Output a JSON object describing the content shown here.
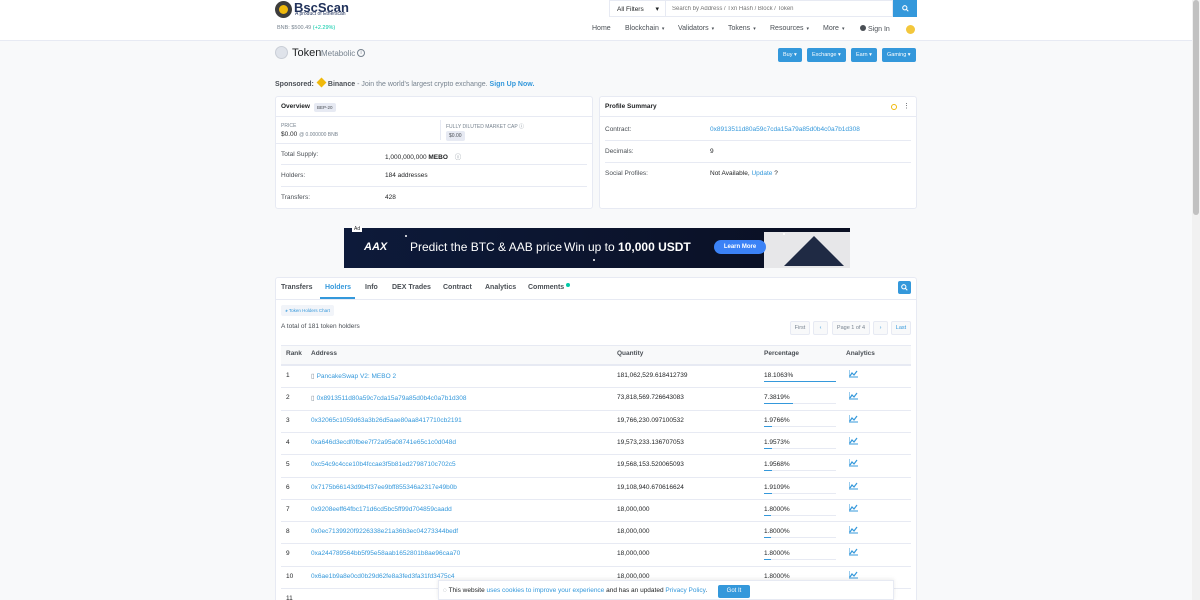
{
  "logo": {
    "name": "BscScan",
    "sub": "A product of Etherscan"
  },
  "bnb_price": {
    "label": "BNB: $500.49",
    "change": "(+2.29%)"
  },
  "search": {
    "filter": "All Filters",
    "placeholder": "Search by Address / Txn Hash / Block / Token"
  },
  "nav": {
    "items": [
      "Home",
      "Blockchain",
      "Validators",
      "Tokens",
      "Resources",
      "More"
    ],
    "signin": "Sign In"
  },
  "page": {
    "title": "Token",
    "subtitle": "Metabolic"
  },
  "actions": [
    "Buy",
    "Exchange",
    "Earn",
    "Gaming"
  ],
  "sponsor": {
    "label": "Sponsored:",
    "brand": "Binance",
    "text": "- Join the world's largest crypto exchange.",
    "cta": "Sign Up Now."
  },
  "overview": {
    "title": "Overview",
    "badge": "BEP-20",
    "price_label": "PRICE",
    "price": "$0.00",
    "price_sub": "@ 0.000000 BNB",
    "mcap_label": "FULLY DILUTED MARKET CAP",
    "mcap": "$0.00",
    "supply_label": "Total Supply:",
    "supply": "1,000,000,000",
    "supply_sym": "MEBO",
    "holders_label": "Holders:",
    "holders": "184 addresses",
    "transfers_label": "Transfers:",
    "transfers": "428"
  },
  "profile": {
    "title": "Profile Summary",
    "contract_label": "Contract:",
    "contract": "0x8913511d80a59c7cda15a79a85d0b4c0a7b1d308",
    "decimals_label": "Decimals:",
    "decimals": "9",
    "social_label": "Social Profiles:",
    "social": "Not Available,",
    "social_link": "Update",
    "social_q": "?"
  },
  "ad": {
    "label": "Ad",
    "brand": "AAX",
    "text": "Predict the BTC & AAB price",
    "win": "Win up to",
    "amount": "10,000 USDT",
    "cta": "Learn More"
  },
  "tabs": [
    "Transfers",
    "Holders",
    "Info",
    "DEX Trades",
    "Contract",
    "Analytics",
    "Comments"
  ],
  "holders_section": {
    "chart_btn": "Token Holders Chart",
    "total": "A total of 181 token holders",
    "pager": {
      "first": "First",
      "prev": "‹",
      "page": "Page 1 of 4",
      "next": "›",
      "last": "Last"
    },
    "headers": [
      "Rank",
      "Address",
      "Quantity",
      "Percentage",
      "Analytics"
    ],
    "rows": [
      {
        "rank": "1",
        "address": "PancakeSwap V2: MEBO 2",
        "qty": "181,062,529.618412739",
        "pct": "18.1063%",
        "pct_value": 18.1063,
        "contract": true
      },
      {
        "rank": "2",
        "address": "0x8913511d80a59c7cda15a79a85d0b4c0a7b1d308",
        "qty": "73,818,569.726643083",
        "pct": "7.3819%",
        "pct_value": 7.3819,
        "contract": true
      },
      {
        "rank": "3",
        "address": "0x32065c1059d63a3b26d5aae80aa8417710cb2191",
        "qty": "19,766,230.097100532",
        "pct": "1.9766%",
        "pct_value": 1.9766,
        "contract": false
      },
      {
        "rank": "4",
        "address": "0xa646d3ecdf0fbee7f72a95a08741e65c1c0d048d",
        "qty": "19,573,233.136707053",
        "pct": "1.9573%",
        "pct_value": 1.9573,
        "contract": false
      },
      {
        "rank": "5",
        "address": "0xc54c9c4cce10b4fccae3f5b81ed2798710c702c5",
        "qty": "19,568,153.520065093",
        "pct": "1.9568%",
        "pct_value": 1.9568,
        "contract": false
      },
      {
        "rank": "6",
        "address": "0x7175b66143d9b4f37ee9bff855346a2317e49b0b",
        "qty": "19,108,940.670616624",
        "pct": "1.9109%",
        "pct_value": 1.9109,
        "contract": false
      },
      {
        "rank": "7",
        "address": "0x9208eeff64fbc171d6cd5bc5ff99d704859caadd",
        "qty": "18,000,000",
        "pct": "1.8000%",
        "pct_value": 1.8,
        "contract": false
      },
      {
        "rank": "8",
        "address": "0x0ec7139920f9226338e21a36b3ec04273344bedf",
        "qty": "18,000,000",
        "pct": "1.8000%",
        "pct_value": 1.8,
        "contract": false
      },
      {
        "rank": "9",
        "address": "0xa244789564bb5f95e58aab1652801b8ae96caa70",
        "qty": "18,000,000",
        "pct": "1.8000%",
        "pct_value": 1.8,
        "contract": false
      },
      {
        "rank": "10",
        "address": "0x6ae1b9a8e0cd0b29d62fe8a3fed3fa31fd3475c4",
        "qty": "18,000,000",
        "pct": "1.8000%",
        "pct_value": 1.8,
        "contract": false
      },
      {
        "rank": "11",
        "address": "",
        "qty": "",
        "pct": "",
        "pct_value": 0,
        "contract": false
      }
    ]
  },
  "cookie": {
    "pre": "This website",
    "link1": "uses cookies to improve your experience",
    "mid": "and has an updated",
    "link2": "Privacy Policy",
    "end": ".",
    "btn": "Got It"
  },
  "colors": {
    "accent": "#3498db",
    "brand": "#21325b",
    "binance": "#f0b90b",
    "positive": "#00c9a7"
  }
}
